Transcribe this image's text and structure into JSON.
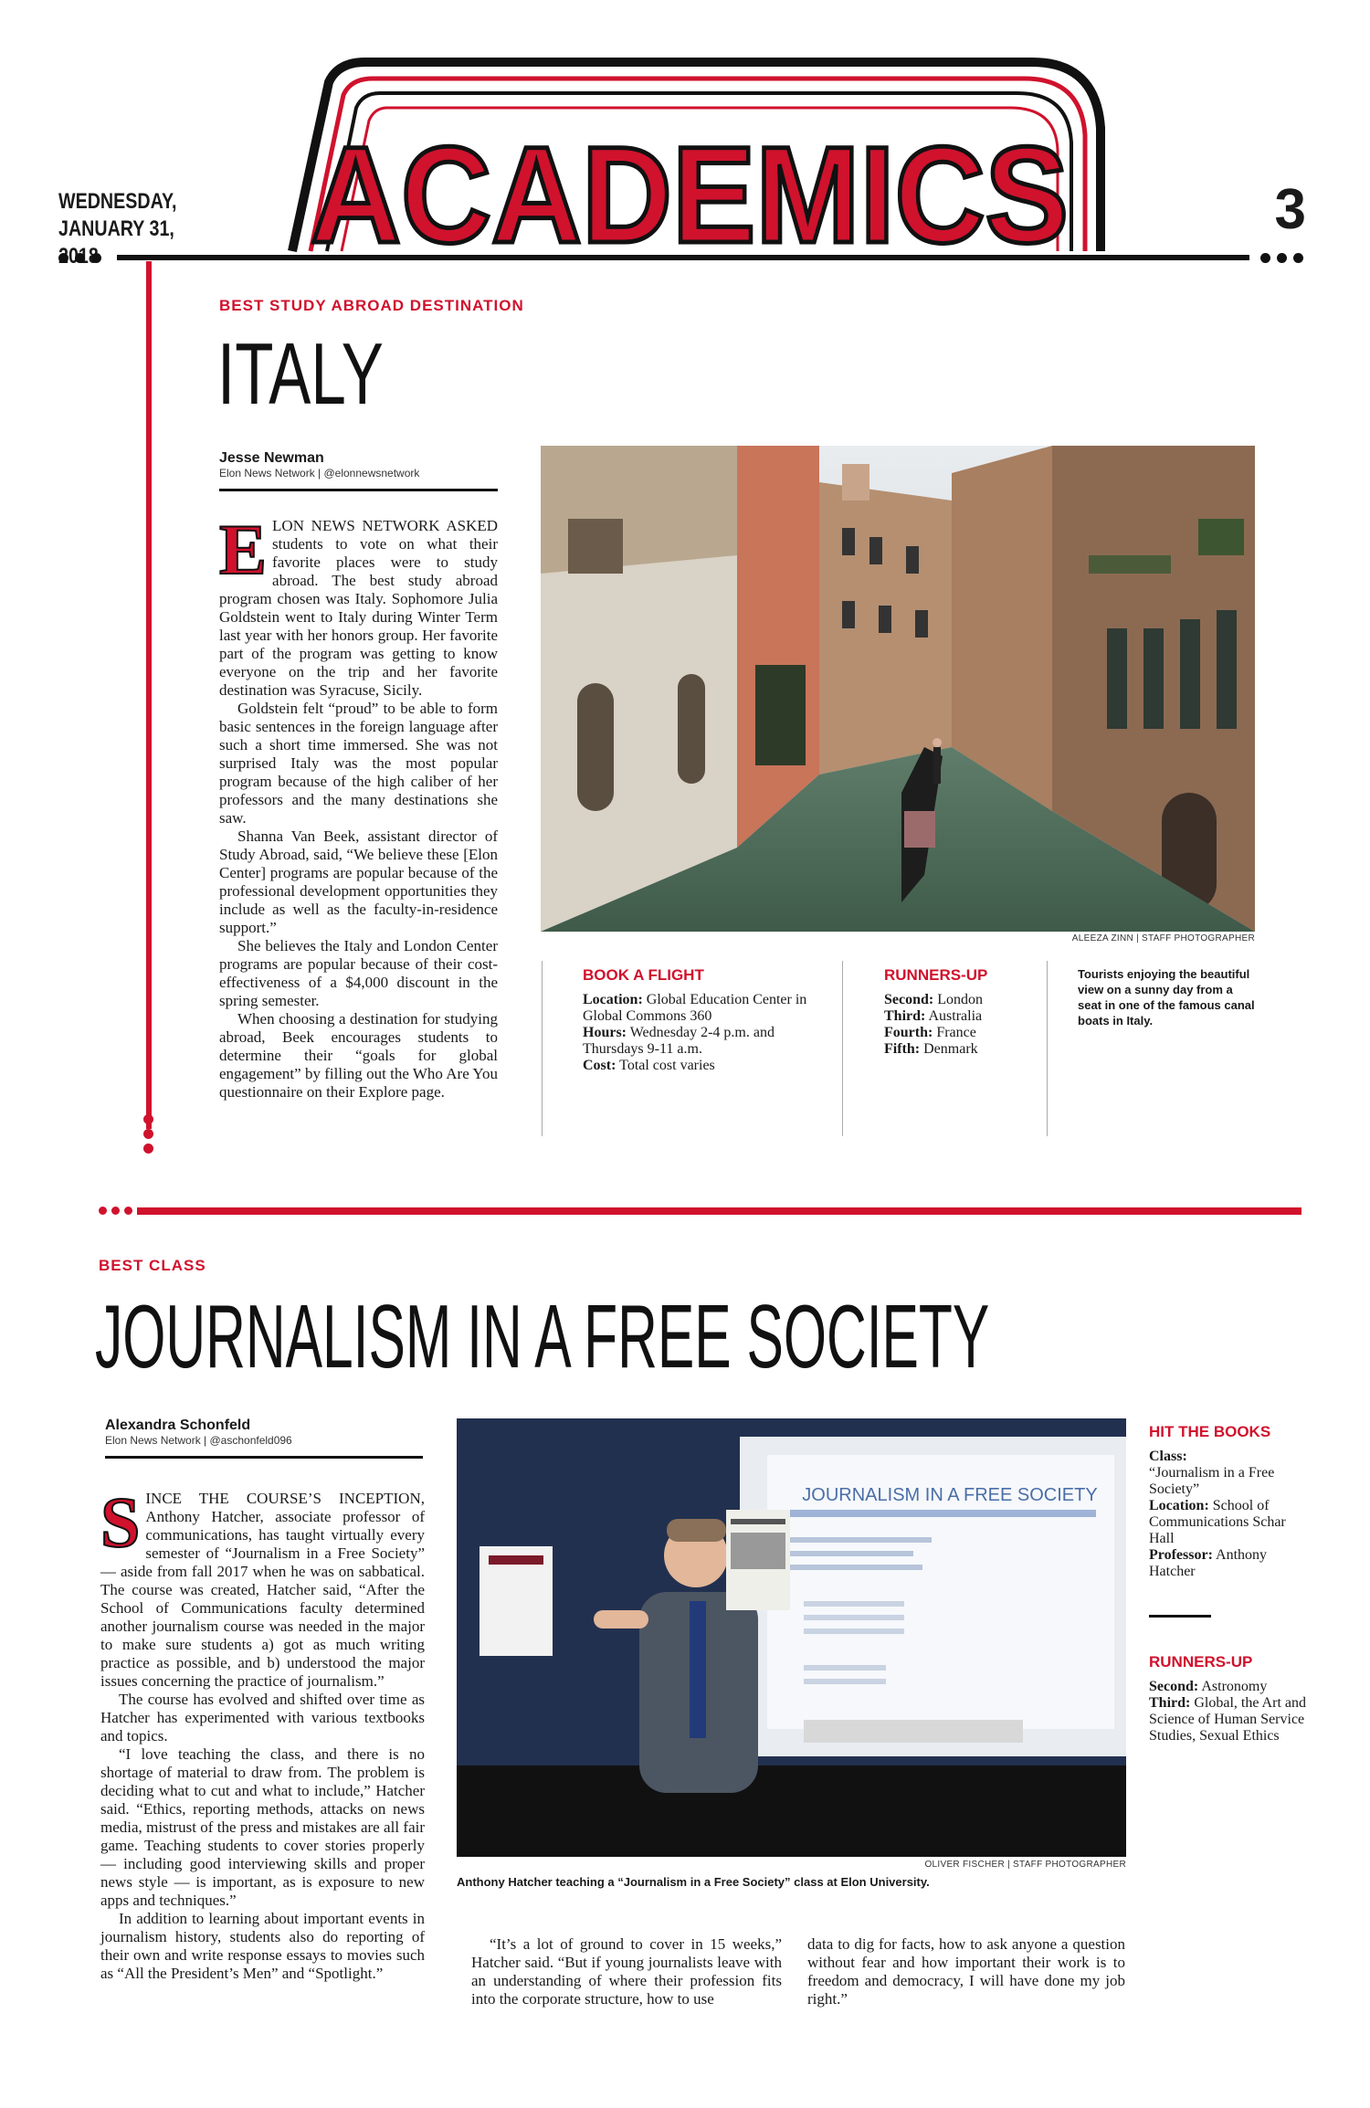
{
  "masthead": {
    "section": "ACADEMICS",
    "date_line1": "WEDNESDAY,",
    "date_line2": "JANUARY 31, 2018",
    "page_number": "3",
    "accent_color": "#d0122d"
  },
  "story1": {
    "kicker": "BEST STUDY ABROAD DESTINATION",
    "headline": "ITALY",
    "author": "Jesse Newman",
    "author_org": "Elon News Network | @elonnewsnetwork",
    "dropcap": "E",
    "paragraphs": [
      "LON NEWS NETWORK ASKED students to vote on what their favorite places were to study abroad. The best study abroad program chosen was Italy. Sophomore Julia Goldstein went to Italy during Winter Term last year with her honors group. Her favorite part of the program was getting to know everyone on the trip and her favorite destination was Syracuse, Sicily.",
      "Goldstein felt “proud” to be able to form basic sentences in the foreign language after such a short time immersed. She was not surprised Italy was the most popular program because of the high caliber of her professors and the many destinations she saw.",
      "Shanna Van Beek, assistant director of Study Abroad, said, “We believe these [Elon Center] programs are popular because of the professional development opportunities they include as well as the faculty-in-residence support.”",
      "She believes the Italy and London Center programs are popular because of their cost-effectiveness of a $4,000 discount in the spring semester.",
      "When choosing a destination for studying abroad, Beek encourages students to determine their “goals for global engagement” by filling out the Who Are You questionnaire on their Explore page."
    ],
    "photo_credit": "ALEEZA ZINN | STAFF PHOTOGRAPHER",
    "caption": "Tourists enjoying the beautiful view on a sunny day from a seat in one of the famous canal boats in Italy.",
    "book_flight": {
      "head": "BOOK A FLIGHT",
      "location_label": "Location:",
      "location": "Global Education Center in Global Commons 360",
      "hours_label": "Hours:",
      "hours": "Wednesday 2-4 p.m. and Thursdays 9-11 a.m.",
      "cost_label": "Cost:",
      "cost": "Total cost varies"
    },
    "runners_up": {
      "head": "RUNNERS-UP",
      "items": [
        {
          "label": "Second:",
          "value": "London"
        },
        {
          "label": "Third:",
          "value": "Australia"
        },
        {
          "label": "Fourth:",
          "value": "France"
        },
        {
          "label": "Fifth:",
          "value": "Denmark"
        }
      ]
    }
  },
  "story2": {
    "kicker": "BEST CLASS",
    "headline": "JOURNALISM IN A FREE SOCIETY",
    "author": "Alexandra Schonfeld",
    "author_org": "Elon News Network | @aschonfeld096",
    "dropcap": "S",
    "paragraphs": [
      "INCE THE COURSE’S INCEPTION, Anthony Hatcher, associate professor of communications, has taught virtually every semester of “Journalism in a Free Society” — aside from fall 2017 when he was on sabbatical. The course was created, Hatcher said, “After the School of Communications faculty determined another journalism course was needed in the major to make sure students a) got as much writing practice as possible, and b) understood the major issues concerning the practice of journalism.”",
      "The course has evolved and shifted over time as Hatcher has experimented with various textbooks and topics.",
      "“I love teaching the class, and there is no shortage of material to draw from. The problem is deciding what to cut and what to include,” Hatcher said. “Ethics, reporting methods, attacks on news media, mistrust of the press and mistakes are all fair game. Teaching students to cover stories properly — including good interviewing skills and proper news style — is important, as is exposure to new apps and techniques.”",
      "In addition to learning about important events in journalism history, students also do reporting of their own and write response essays to movies such as “All the President’s Men” and “Spotlight.”"
    ],
    "col2": "“It’s a lot of ground to cover in 15 weeks,” Hatcher said. “But if young journalists leave with an understanding of where their profession fits into the corporate structure, how to use",
    "col3": "data to dig for facts, how to ask anyone a question without fear and how important their work is to freedom and democracy, I will have done my job right.”",
    "photo_credit": "OLIVER FISCHER | STAFF PHOTOGRAPHER",
    "caption": "Anthony Hatcher teaching a “Journalism in a Free Society” class at Elon University.",
    "slide_title": "JOURNALISM IN A FREE SOCIETY",
    "hit_books": {
      "head": "HIT THE BOOKS",
      "class_label": "Class:",
      "class": "“Journalism in a Free Society”",
      "location_label": "Location:",
      "location": "School of Communications Schar Hall",
      "professor_label": "Professor:",
      "professor": "Anthony Hatcher"
    },
    "runners_up": {
      "head": "RUNNERS-UP",
      "items": [
        {
          "label": "Second:",
          "value": "Astronomy"
        },
        {
          "label": "Third:",
          "value": "Global, the Art and Science of Human Service Studies, Sexual Ethics"
        }
      ]
    }
  }
}
